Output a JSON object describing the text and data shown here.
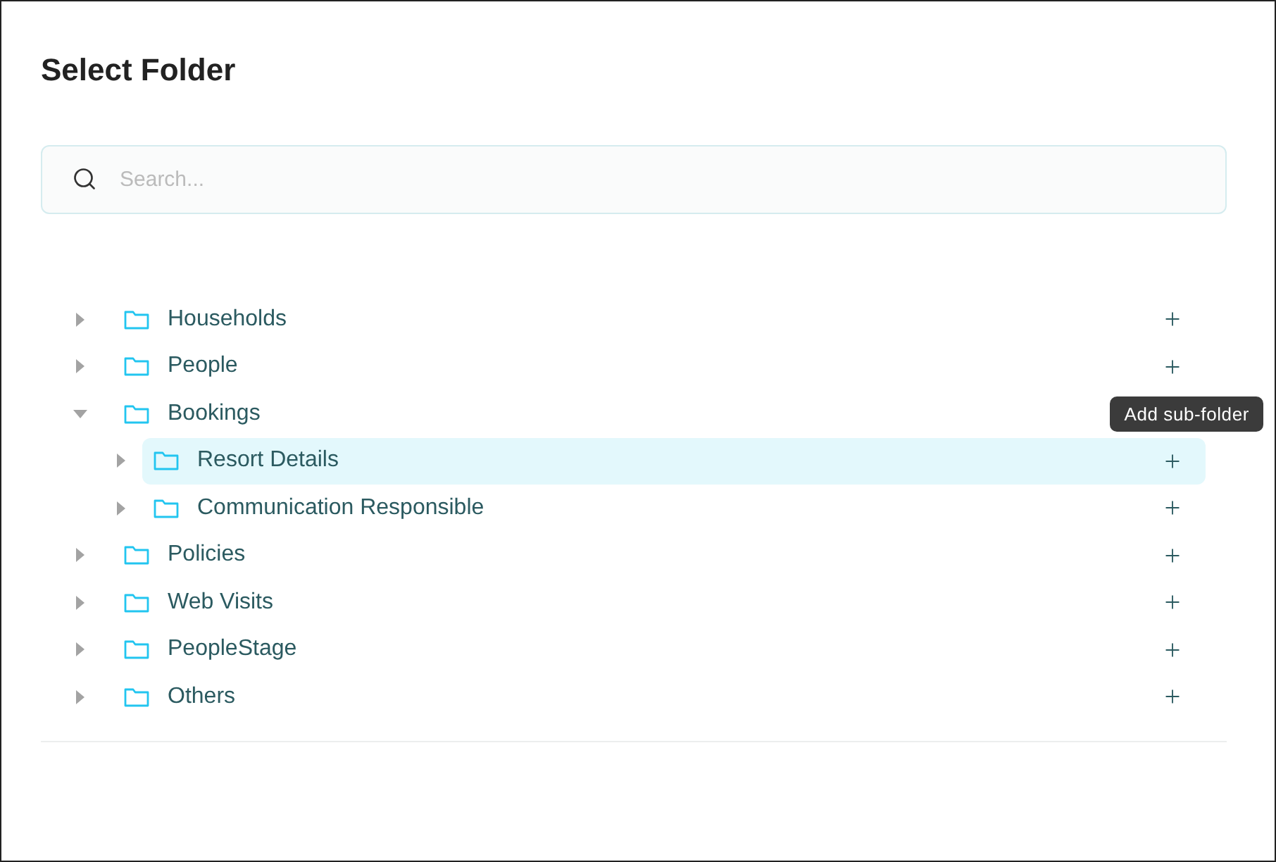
{
  "dialog": {
    "title": "Select Folder"
  },
  "search": {
    "placeholder": "Search..."
  },
  "tree": [
    {
      "label": "Households",
      "expanded": false,
      "selected": false
    },
    {
      "label": "People",
      "expanded": false,
      "selected": false
    },
    {
      "label": "Bookings",
      "expanded": true,
      "selected": false,
      "tooltip": "Add sub-folder",
      "children": [
        {
          "label": "Resort Details",
          "expanded": false,
          "selected": true
        },
        {
          "label": "Communication Responsible",
          "expanded": false,
          "selected": false
        }
      ]
    },
    {
      "label": "Policies",
      "expanded": false,
      "selected": false
    },
    {
      "label": "Web Visits",
      "expanded": false,
      "selected": false
    },
    {
      "label": "PeopleStage",
      "expanded": false,
      "selected": false
    },
    {
      "label": "Others",
      "expanded": false,
      "selected": false
    }
  ]
}
